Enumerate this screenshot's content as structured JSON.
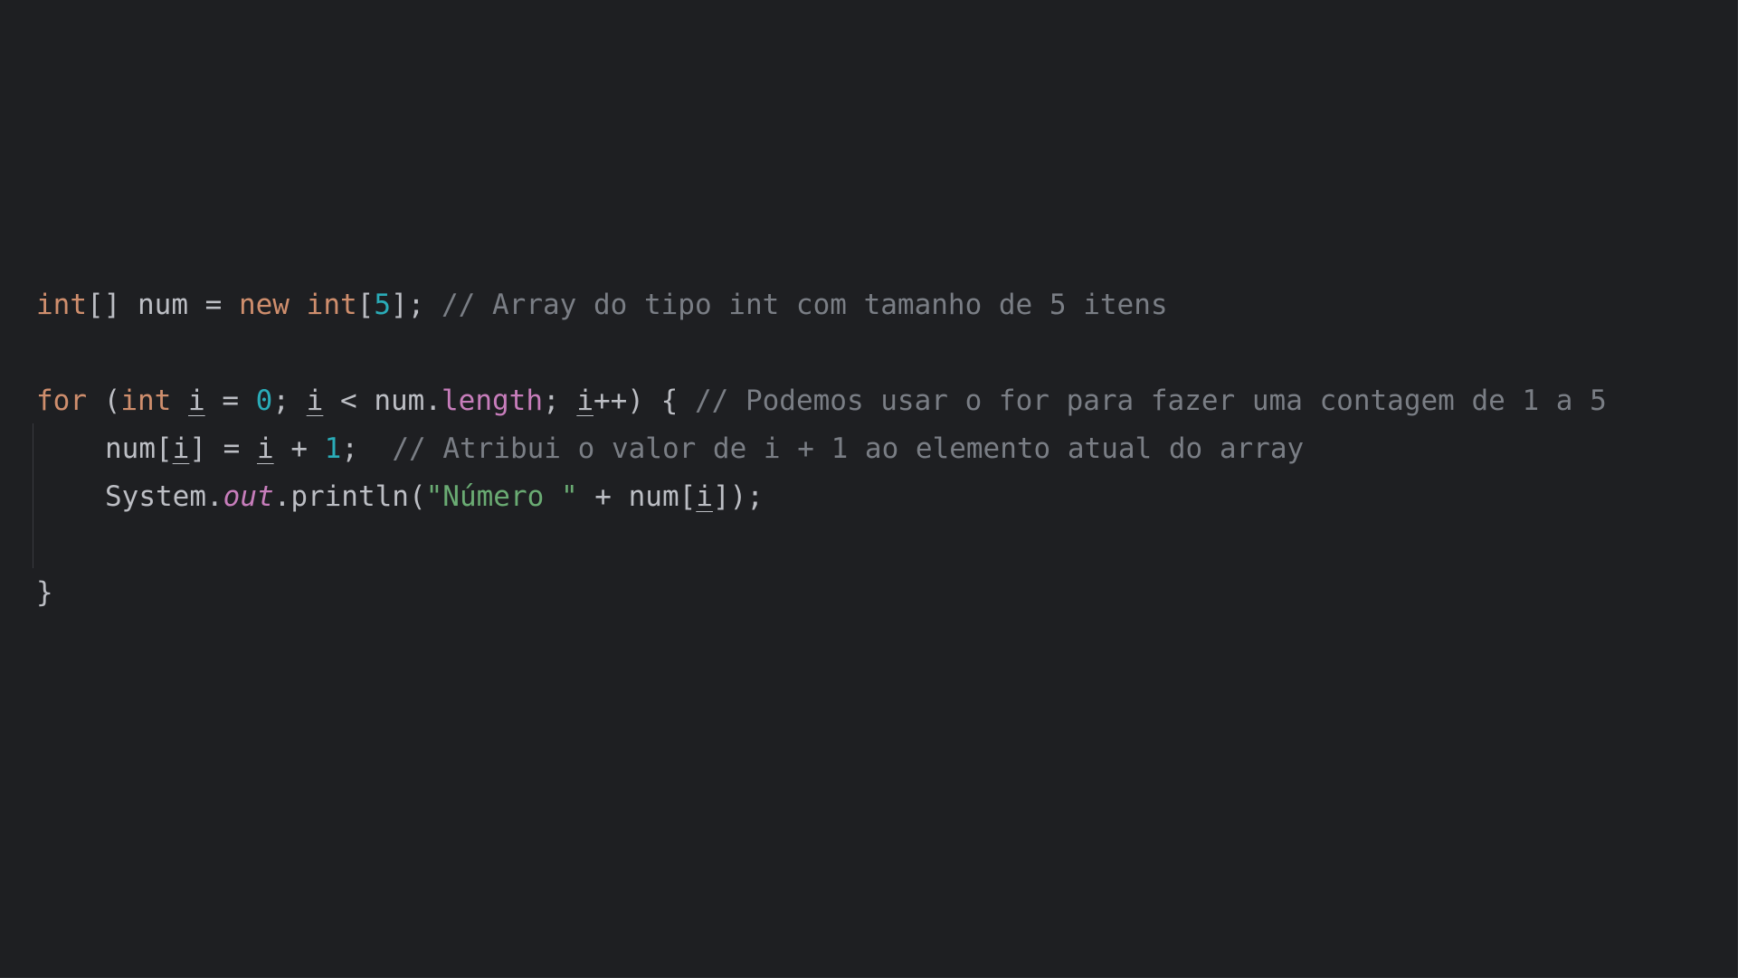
{
  "editor": {
    "lines": [
      {
        "tokens": [
          {
            "t": "int",
            "c": "kw"
          },
          {
            "t": "[] num = ",
            "c": "plain"
          },
          {
            "t": "new",
            "c": "kw"
          },
          {
            "t": " ",
            "c": "plain"
          },
          {
            "t": "int",
            "c": "kw"
          },
          {
            "t": "[",
            "c": "plain"
          },
          {
            "t": "5",
            "c": "num"
          },
          {
            "t": "]; ",
            "c": "plain"
          },
          {
            "t": "// Array do tipo int com tamanho de 5 itens",
            "c": "cmt"
          }
        ]
      },
      {
        "tokens": []
      },
      {
        "tokens": [
          {
            "t": "for",
            "c": "kw"
          },
          {
            "t": " (",
            "c": "plain"
          },
          {
            "t": "int",
            "c": "kw"
          },
          {
            "t": " ",
            "c": "plain"
          },
          {
            "t": "i",
            "c": "var"
          },
          {
            "t": " = ",
            "c": "plain"
          },
          {
            "t": "0",
            "c": "num"
          },
          {
            "t": "; ",
            "c": "plain"
          },
          {
            "t": "i",
            "c": "var"
          },
          {
            "t": " < num.",
            "c": "plain"
          },
          {
            "t": "length",
            "c": "fld"
          },
          {
            "t": "; ",
            "c": "plain"
          },
          {
            "t": "i",
            "c": "var"
          },
          {
            "t": "++) { ",
            "c": "plain"
          },
          {
            "t": "// Podemos usar o for para fazer uma contagem de 1 a 5",
            "c": "cmt"
          }
        ]
      },
      {
        "indent": true,
        "tokens": [
          {
            "t": "num[",
            "c": "plain"
          },
          {
            "t": "i",
            "c": "var"
          },
          {
            "t": "] = ",
            "c": "plain"
          },
          {
            "t": "i",
            "c": "var"
          },
          {
            "t": " + ",
            "c": "plain"
          },
          {
            "t": "1",
            "c": "num"
          },
          {
            "t": ";  ",
            "c": "plain"
          },
          {
            "t": "// Atribui o valor de i + 1 ao elemento atual do array",
            "c": "cmt"
          }
        ]
      },
      {
        "indent": true,
        "tokens": [
          {
            "t": "System.",
            "c": "plain"
          },
          {
            "t": "out",
            "c": "sfld"
          },
          {
            "t": ".println(",
            "c": "plain"
          },
          {
            "t": "\"Número \"",
            "c": "str"
          },
          {
            "t": " + num[",
            "c": "plain"
          },
          {
            "t": "i",
            "c": "var"
          },
          {
            "t": "]);",
            "c": "plain"
          }
        ]
      },
      {
        "tokens": []
      },
      {
        "tokens": [
          {
            "t": "}",
            "c": "plain"
          }
        ]
      }
    ]
  }
}
